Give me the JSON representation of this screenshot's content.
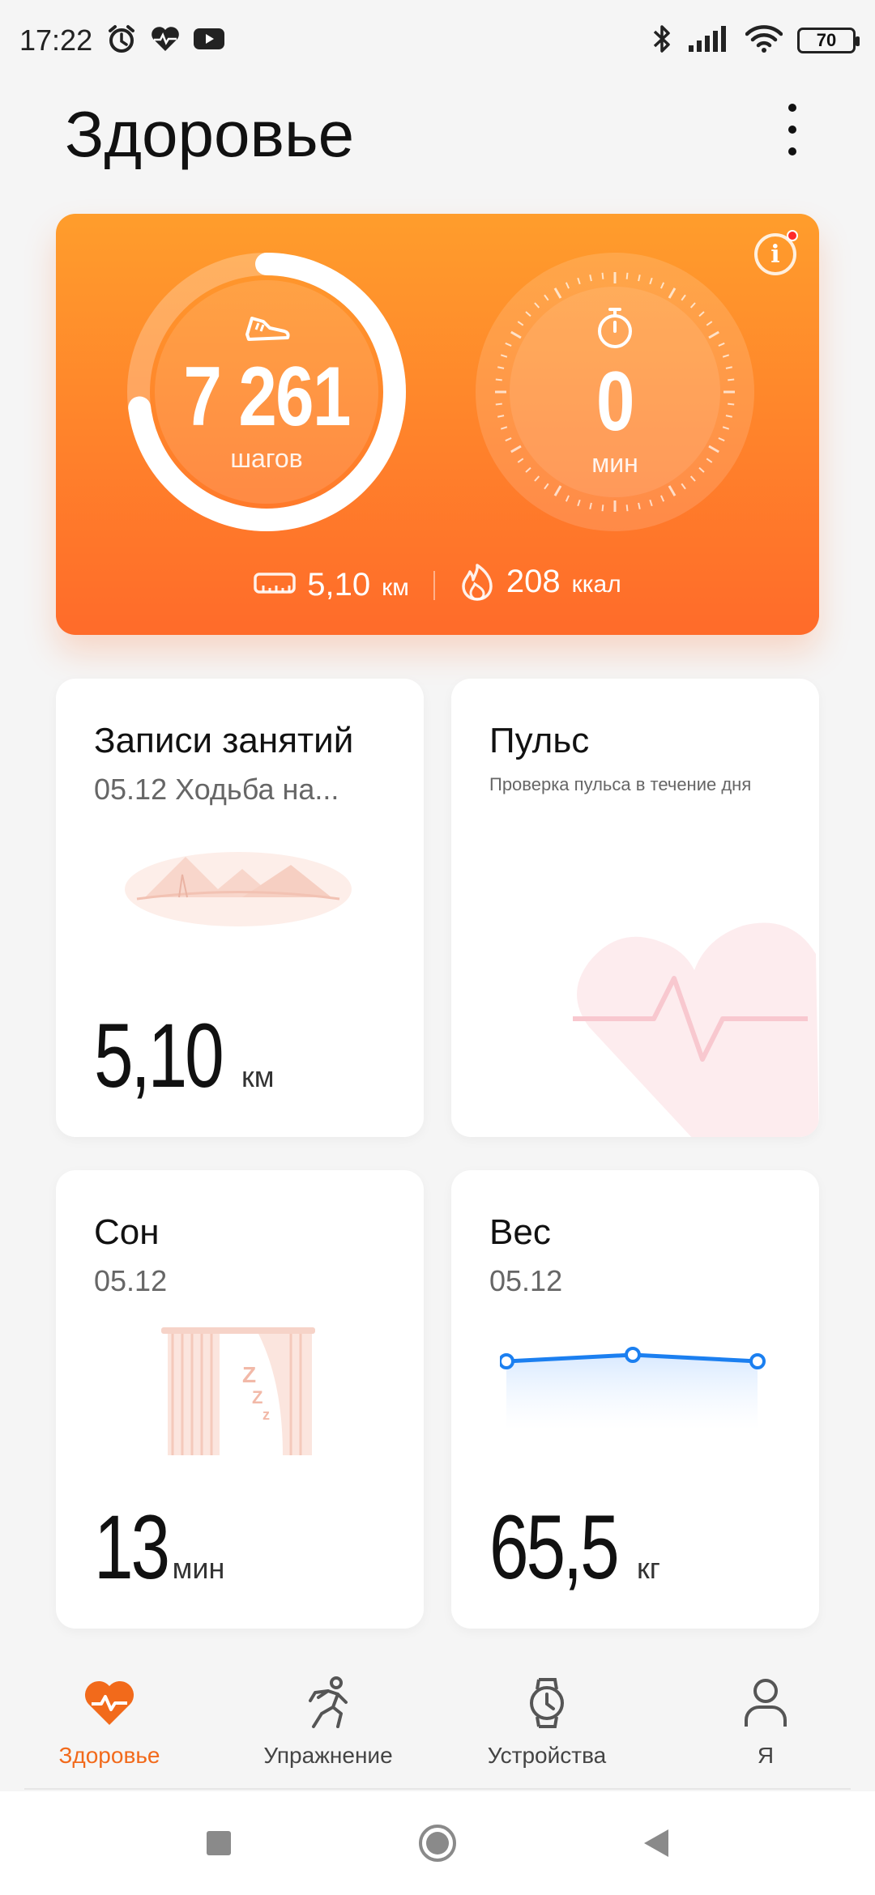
{
  "status_bar": {
    "time": "17:22",
    "battery": "70",
    "left_icons": [
      "alarm-icon",
      "heart-rate-icon",
      "youtube-icon"
    ],
    "right_icons": [
      "bluetooth-icon",
      "signal-icon",
      "wifi-icon",
      "battery-icon"
    ]
  },
  "header": {
    "title": "Здоровье",
    "menu_icon": "more-vertical-icon"
  },
  "activity": {
    "steps_value": "7 261",
    "steps_unit": "шагов",
    "steps_progress": 0.73,
    "time_value": "0",
    "time_unit": "мин",
    "distance_value": "5,10",
    "distance_unit": "км",
    "calories_value": "208",
    "calories_unit": "ккал",
    "colors": {
      "from": "#ff9d2c",
      "to": "#ff6b2a"
    }
  },
  "tiles": {
    "workouts": {
      "title": "Записи занятий",
      "subtitle": "05.12 Ходьба на...",
      "value": "5,10",
      "unit": "км"
    },
    "pulse": {
      "title": "Пульс",
      "subtitle": "Проверка пульса в течение дня"
    },
    "sleep": {
      "title": "Сон",
      "subtitle": "05.12",
      "value": "13",
      "unit": "мин"
    },
    "weight": {
      "title": "Вес",
      "subtitle": "05.12",
      "value": "65,5",
      "unit": "кг"
    }
  },
  "bottom_nav": [
    {
      "label": "Здоровье",
      "icon": "heart-icon",
      "active": true
    },
    {
      "label": "Упражнение",
      "icon": "running-icon",
      "active": false
    },
    {
      "label": "Устройства",
      "icon": "watch-icon",
      "active": false
    },
    {
      "label": "Я",
      "icon": "profile-icon",
      "active": false
    }
  ],
  "accent_color": "#f26a1b"
}
